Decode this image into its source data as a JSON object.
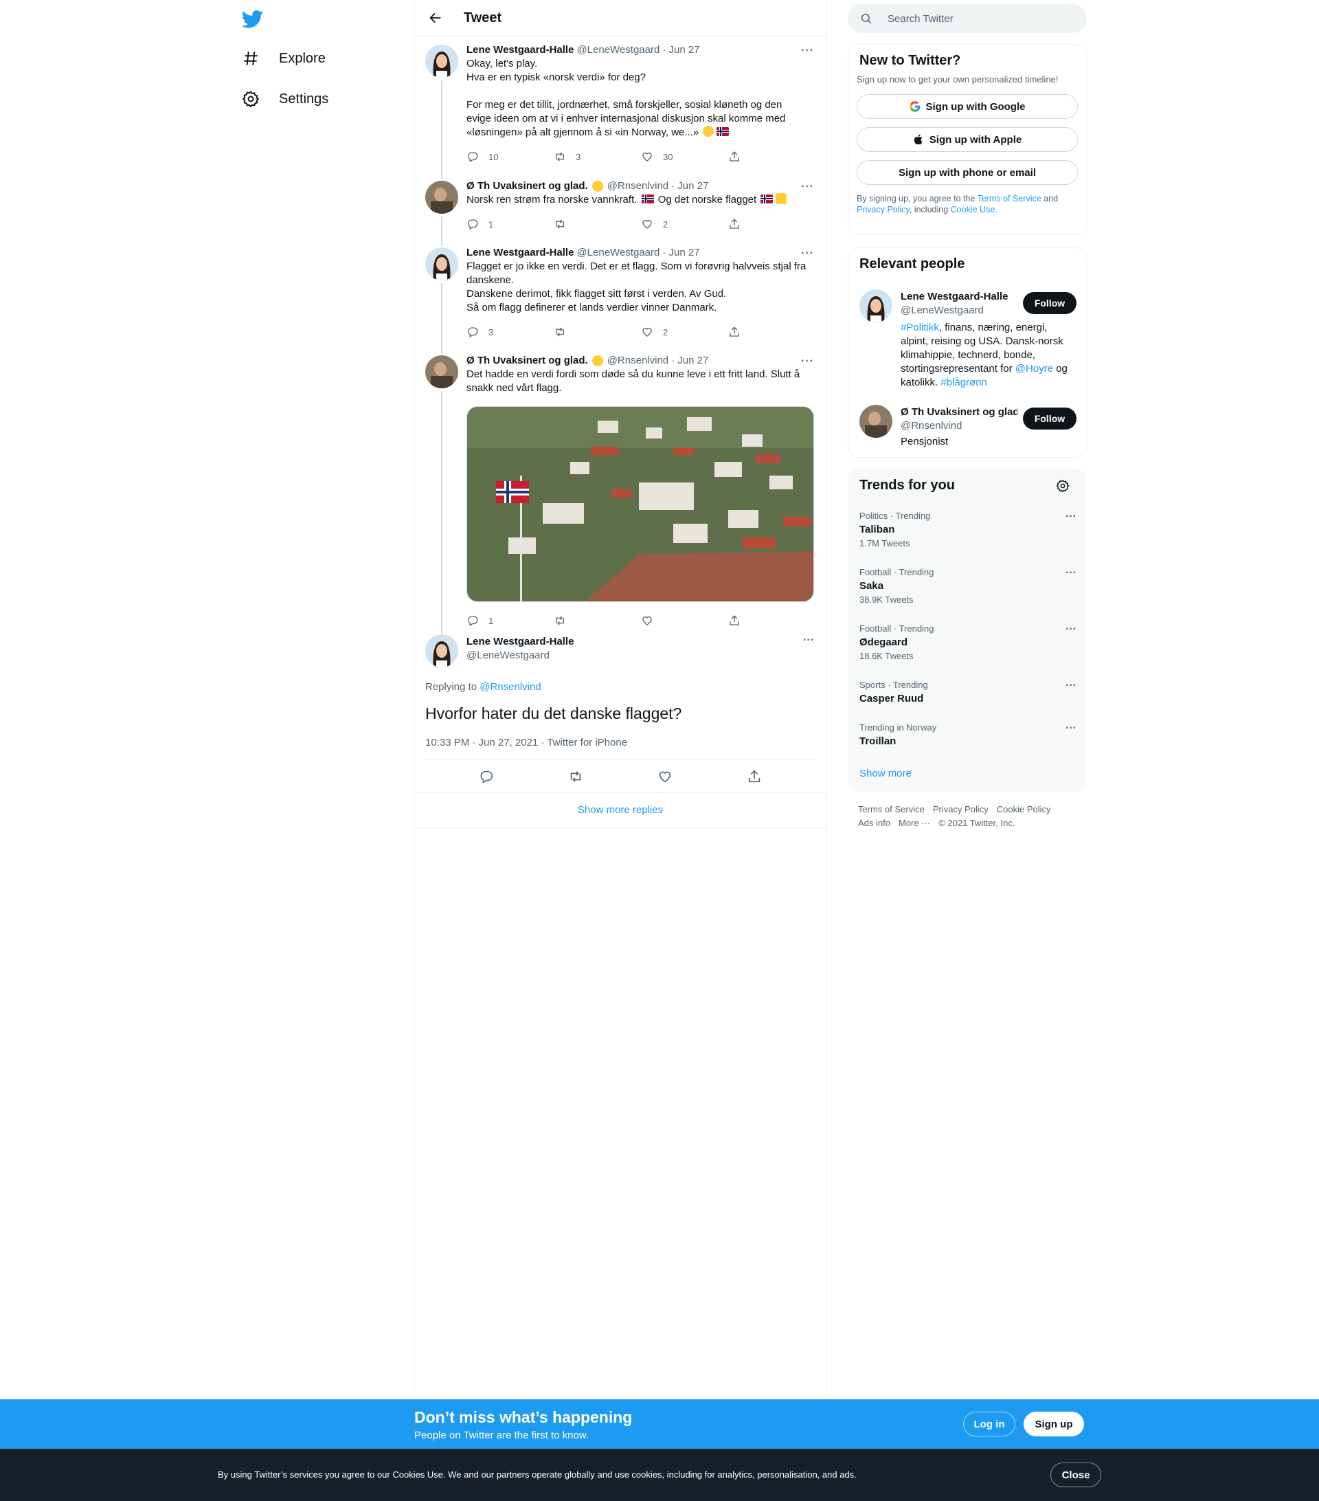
{
  "nav": {
    "items": [
      {
        "label": "Explore",
        "icon": "hashtag-icon"
      },
      {
        "label": "Settings",
        "icon": "gear-icon"
      }
    ]
  },
  "header": {
    "title": "Tweet"
  },
  "thread": [
    {
      "name": "Lene Westgaard-Halle",
      "handle": "@LeneWestgaard",
      "date": "· Jun 27",
      "lines": [
        "Okay, let's play.",
        "Hva er en typisk «norsk verdi» for deg?",
        "",
        "For meg er det tillit, jordnærhet, små forskjeller, sosial kløneth og den",
        "evige ideen om at vi i enhver internasjonal diskusjon skal komme med",
        "«løsningen» på alt gjennom å si «in Norway, we...»"
      ],
      "replies": "10",
      "retweets": "3",
      "likes": "30"
    },
    {
      "name": "Ø Th Uvaksinert og glad.",
      "handle": "@Rnsenlvind",
      "date": "· Jun 27",
      "text_a": "Norsk ren strøm fra norske vannkraft.",
      "text_b": "Og det norske flagget",
      "replies": "1",
      "retweets": "",
      "likes": "2"
    },
    {
      "name": "Lene Westgaard-Halle",
      "handle": "@LeneWestgaard",
      "date": "· Jun 27",
      "lines": [
        "Flagget er jo ikke en verdi. Det er et flagg. Som vi forøvrig halvveis stjal fra",
        "danskene.",
        "Danskene derimot, fikk flagget sitt først i verden. Av Gud.",
        "Så om flagg definerer et lands verdier vinner Danmark."
      ],
      "replies": "3",
      "retweets": "",
      "likes": "2"
    },
    {
      "name": "Ø Th Uvaksinert og glad.",
      "handle": "@Rnsenlvind",
      "date": "· Jun 27",
      "lines": [
        "Det hadde en verdi fordi som døde så du kunne leve i ett fritt land. Slutt å",
        "snakk ned vårt flagg."
      ],
      "replies": "1",
      "retweets": "",
      "likes": ""
    }
  ],
  "focused": {
    "name": "Lene Westgaard-Halle",
    "handle": "@LeneWestgaard",
    "replying_label": "Replying to",
    "replying_to": "@Rnsenlvind",
    "text": "Hvorfor hater du det danske flagget?",
    "meta": "10:33 PM · Jun 27, 2021 · Twitter for iPhone"
  },
  "show_more_replies": "Show more replies",
  "search": {
    "placeholder": "Search Twitter"
  },
  "signup": {
    "title": "New to Twitter?",
    "subtitle": "Sign up now to get your own personalized timeline!",
    "google": "Sign up with Google",
    "apple": "Sign up with Apple",
    "phone": "Sign up with phone or email",
    "legal_a": "By signing up, you agree to the",
    "tos": "Terms of Service",
    "legal_b": "and",
    "privacy": "Privacy Policy",
    "legal_c": ", including",
    "cookie": "Cookie Use."
  },
  "relevant": {
    "title": "Relevant people",
    "follow": "Follow",
    "people": [
      {
        "name": "Lene Westgaard-Halle",
        "handle": "@LeneWestgaard",
        "bio_tag1": "#Politikk",
        "bio_a": ", finans, næring, energi, alpint, reising og USA. Dansk-norsk klimahippie, technerd, bonde, stortingsrepresentant for",
        "bio_tag2": "@Hoyre",
        "bio_b": "og katolikk.",
        "bio_tag3": "#blågrønn"
      },
      {
        "name": "Ø Th Uvaksinert og glad.",
        "handle": "@Rnsenlvind",
        "bio": "Pensjonist"
      }
    ]
  },
  "trends": {
    "title": "Trends for you",
    "items": [
      {
        "category": "Politics · Trending",
        "name": "Taliban",
        "count": "1.7M Tweets"
      },
      {
        "category": "Football · Trending",
        "name": "Saka",
        "count": "38.9K Tweets"
      },
      {
        "category": "Football · Trending",
        "name": "Ødegaard",
        "count": "18.6K Tweets"
      },
      {
        "category": "Sports · Trending",
        "name": "Casper Ruud",
        "count": ""
      },
      {
        "category": "Trending in Norway",
        "name": "Troillan",
        "count": ""
      }
    ],
    "show_more": "Show more"
  },
  "footer": {
    "links": [
      "Terms of Service",
      "Privacy Policy",
      "Cookie Policy"
    ],
    "links2": [
      "Ads info",
      "More ···",
      "© 2021 Twitter, Inc."
    ]
  },
  "banner": {
    "title": "Don’t miss what’s happening",
    "subtitle": "People on Twitter are the first to know.",
    "login": "Log in",
    "signup": "Sign up"
  },
  "cookie_bar": {
    "text": "By using Twitter’s services you agree to our Cookies Use. We and our partners operate globally and use cookies, including for analytics, personalisation, and ads.",
    "close": "Close"
  },
  "colors": {
    "accent": "#1d9bf0",
    "text": "#0f1419",
    "muted": "#536471"
  }
}
